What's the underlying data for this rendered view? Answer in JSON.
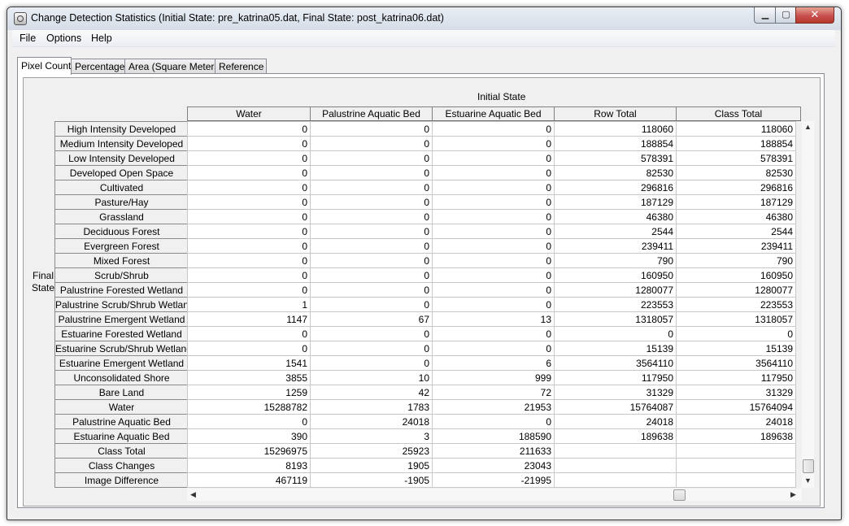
{
  "window": {
    "title": "Change Detection Statistics (Initial State: pre_katrina05.dat, Final State: post_katrina06.dat)",
    "minimize_glyph": "▁",
    "maximize_glyph": "▢",
    "close_glyph": "✕"
  },
  "menu": {
    "file": "File",
    "options": "Options",
    "help": "Help"
  },
  "tabs": [
    {
      "label": "Pixel Count",
      "active": true
    },
    {
      "label": "Percentage",
      "active": false
    },
    {
      "label": "Area (Square Meters)",
      "active": false
    },
    {
      "label": "Reference",
      "active": false
    }
  ],
  "table": {
    "initial_state_label": "Initial State",
    "final_state_label_line1": "Final",
    "final_state_label_line2": "State",
    "columns": [
      "Water",
      "Palustrine Aquatic Bed",
      "Estuarine Aquatic Bed",
      "Row Total",
      "Class Total"
    ],
    "rows": [
      {
        "label": "High Intensity Developed",
        "values": [
          "0",
          "0",
          "0",
          "118060",
          "118060"
        ]
      },
      {
        "label": "Medium Intensity Developed",
        "values": [
          "0",
          "0",
          "0",
          "188854",
          "188854"
        ]
      },
      {
        "label": "Low Intensity Developed",
        "values": [
          "0",
          "0",
          "0",
          "578391",
          "578391"
        ]
      },
      {
        "label": "Developed Open Space",
        "values": [
          "0",
          "0",
          "0",
          "82530",
          "82530"
        ]
      },
      {
        "label": "Cultivated",
        "values": [
          "0",
          "0",
          "0",
          "296816",
          "296816"
        ]
      },
      {
        "label": "Pasture/Hay",
        "values": [
          "0",
          "0",
          "0",
          "187129",
          "187129"
        ]
      },
      {
        "label": "Grassland",
        "values": [
          "0",
          "0",
          "0",
          "46380",
          "46380"
        ]
      },
      {
        "label": "Deciduous Forest",
        "values": [
          "0",
          "0",
          "0",
          "2544",
          "2544"
        ]
      },
      {
        "label": "Evergreen Forest",
        "values": [
          "0",
          "0",
          "0",
          "239411",
          "239411"
        ]
      },
      {
        "label": "Mixed Forest",
        "values": [
          "0",
          "0",
          "0",
          "790",
          "790"
        ]
      },
      {
        "label": "Scrub/Shrub",
        "values": [
          "0",
          "0",
          "0",
          "160950",
          "160950"
        ]
      },
      {
        "label": "Palustrine Forested Wetland",
        "values": [
          "0",
          "0",
          "0",
          "1280077",
          "1280077"
        ]
      },
      {
        "label": "Palustrine Scrub/Shrub Wetland",
        "values": [
          "1",
          "0",
          "0",
          "223553",
          "223553"
        ]
      },
      {
        "label": "Palustrine Emergent Wetland",
        "values": [
          "1147",
          "67",
          "13",
          "1318057",
          "1318057"
        ]
      },
      {
        "label": "Estuarine Forested Wetland",
        "values": [
          "0",
          "0",
          "0",
          "0",
          "0"
        ]
      },
      {
        "label": "Estuarine Scrub/Shrub Wetland",
        "values": [
          "0",
          "0",
          "0",
          "15139",
          "15139"
        ]
      },
      {
        "label": "Estuarine Emergent Wetland",
        "values": [
          "1541",
          "0",
          "6",
          "3564110",
          "3564110"
        ]
      },
      {
        "label": "Unconsolidated Shore",
        "values": [
          "3855",
          "10",
          "999",
          "117950",
          "117950"
        ]
      },
      {
        "label": "Bare Land",
        "values": [
          "1259",
          "42",
          "72",
          "31329",
          "31329"
        ]
      },
      {
        "label": "Water",
        "values": [
          "15288782",
          "1783",
          "21953",
          "15764087",
          "15764094"
        ]
      },
      {
        "label": "Palustrine Aquatic Bed",
        "values": [
          "0",
          "24018",
          "0",
          "24018",
          "24018"
        ]
      },
      {
        "label": "Estuarine Aquatic Bed",
        "values": [
          "390",
          "3",
          "188590",
          "189638",
          "189638"
        ]
      },
      {
        "label": "Class Total",
        "values": [
          "15296975",
          "25923",
          "211633",
          "",
          ""
        ]
      },
      {
        "label": "Class Changes",
        "values": [
          "8193",
          "1905",
          "23043",
          "",
          ""
        ]
      },
      {
        "label": "Image Difference",
        "values": [
          "467119",
          "-1905",
          "-21995",
          "",
          ""
        ]
      }
    ]
  },
  "scroll": {
    "up": "▲",
    "down": "▼",
    "left": "◀",
    "right": "▶"
  }
}
